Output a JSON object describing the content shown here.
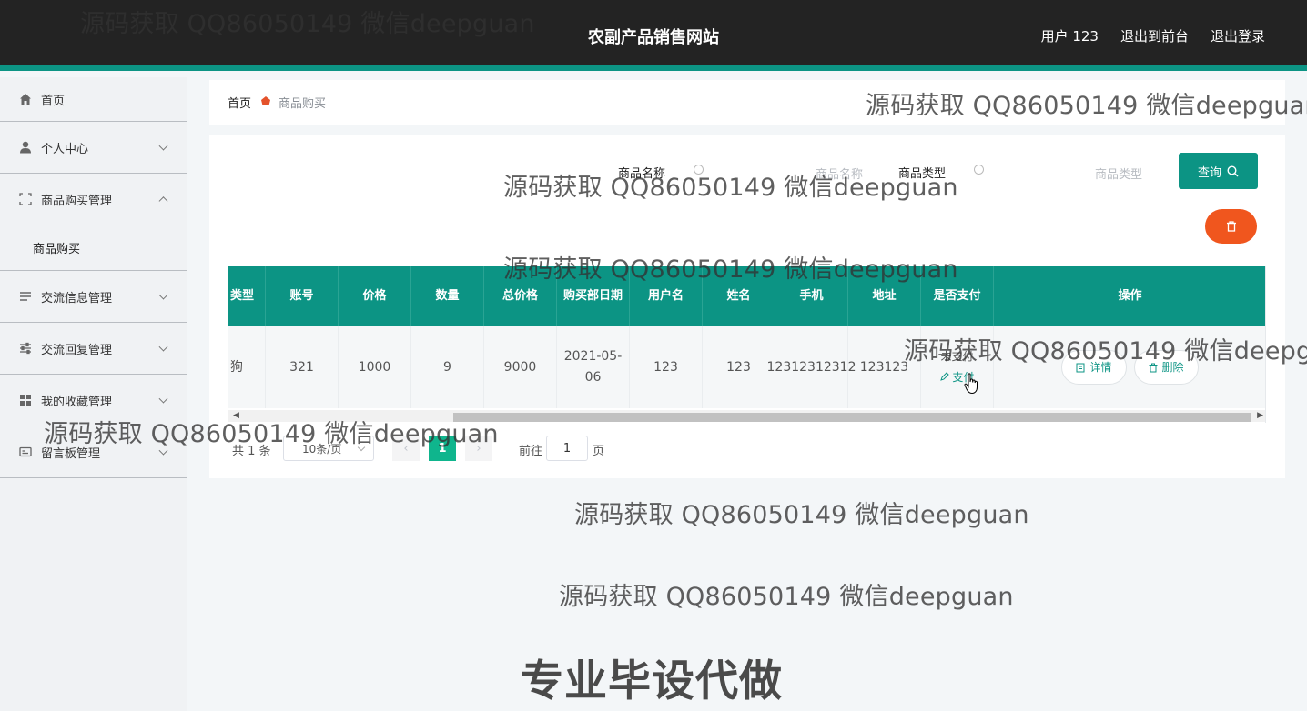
{
  "header": {
    "title": "农副产品销售网站",
    "user": "用户 123",
    "to_front": "退出到前台",
    "logout": "退出登录"
  },
  "sidebar": {
    "items": [
      {
        "label": "首页",
        "icon": "home-icon"
      },
      {
        "label": "个人中心",
        "icon": "user-icon"
      },
      {
        "label": "商品购买管理",
        "icon": "frame-icon",
        "expanded": true,
        "children": [
          "商品购买"
        ]
      },
      {
        "label": "交流信息管理",
        "icon": "list-icon"
      },
      {
        "label": "交流回复管理",
        "icon": "sliders-icon"
      },
      {
        "label": "我的收藏管理",
        "icon": "grid-icon"
      },
      {
        "label": "留言板管理",
        "icon": "card-icon"
      }
    ]
  },
  "breadcrumb": {
    "home": "首页",
    "current": "商品购买"
  },
  "search": {
    "name_label": "商品名称",
    "name_placeholder": "商品名称",
    "type_label": "商品类型",
    "type_placeholder": "商品类型",
    "query_label": "查询"
  },
  "table": {
    "columns": [
      "类型",
      "账号",
      "价格",
      "数量",
      "总价格",
      "购买部日期",
      "用户名",
      "姓名",
      "手机",
      "地址",
      "是否支付",
      "操作"
    ],
    "rows": [
      {
        "type": "狗",
        "account": "321",
        "price": "1000",
        "qty": "9",
        "total": "9000",
        "date": "2021-05-06",
        "username": "123",
        "name": "123",
        "phone": "12312312312",
        "address": "123123",
        "pay_status": "未支付",
        "pay_action": "支付",
        "detail_label": "详情",
        "delete_label": "删除"
      }
    ]
  },
  "pagination": {
    "total": "共 1 条",
    "page_size": "10条/页",
    "current_page": "1",
    "goto_label": "前往",
    "goto_value": "1",
    "page_unit": "页"
  },
  "watermark": {
    "text": "源码获取 QQ86050149 微信deepguan",
    "big": "专业毕设代做"
  },
  "colors": {
    "primary": "#0c9484",
    "danger": "#f0561e",
    "topbar": "#232323"
  }
}
